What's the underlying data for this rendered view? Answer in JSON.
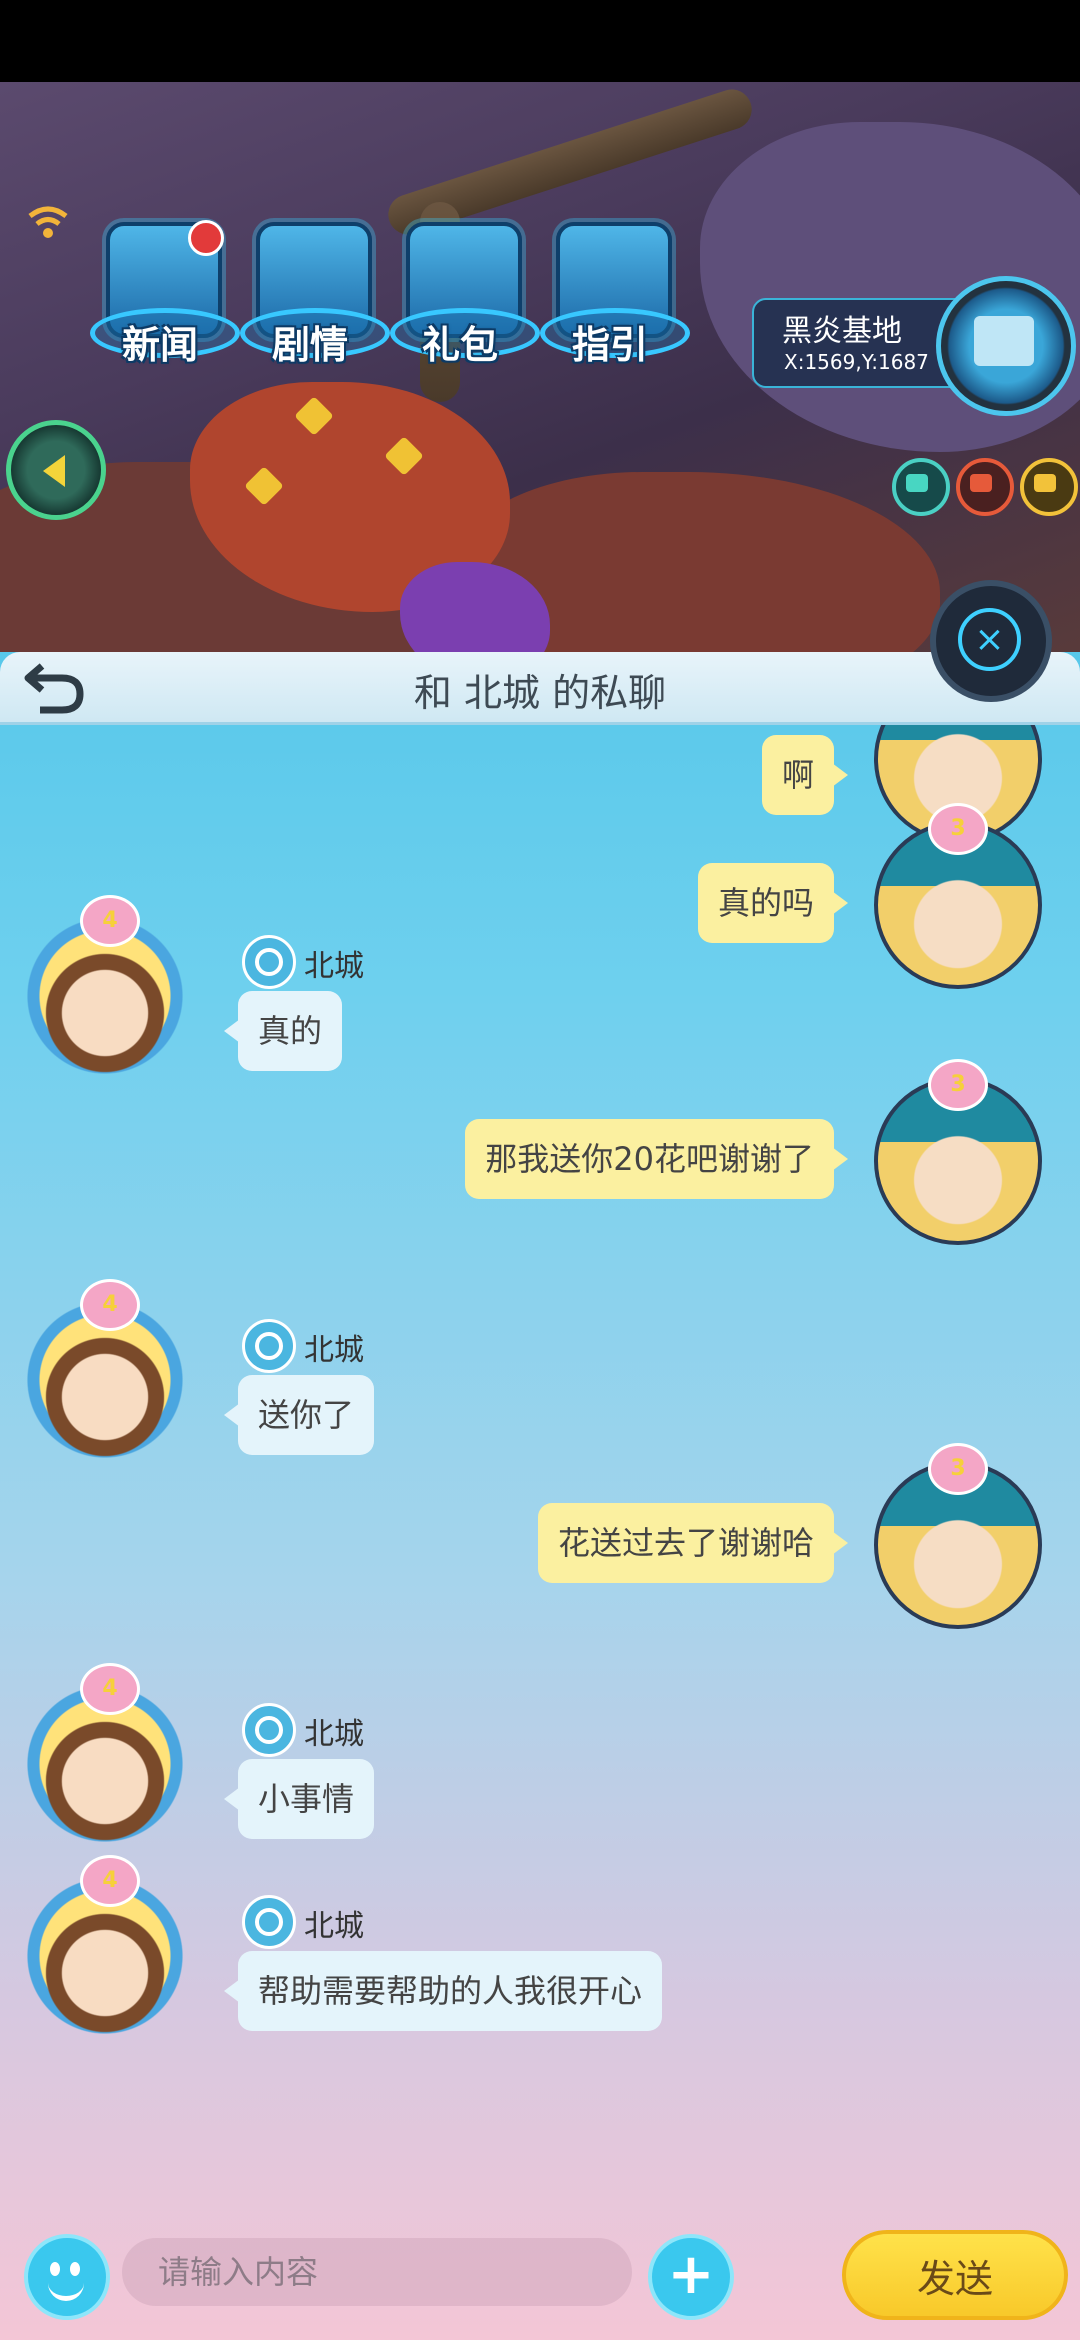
{
  "game_menu": {
    "items": [
      {
        "label": "新闻",
        "badge_dot": true
      },
      {
        "label": "剧情"
      },
      {
        "label": "礼包"
      },
      {
        "label": "指引"
      }
    ]
  },
  "location": {
    "name": "黑炎基地",
    "coords": "X:1569,Y:1687"
  },
  "chat": {
    "title": "和 北城 的私聊",
    "partner_name": "北城",
    "partner_level": "4",
    "my_level": "3",
    "messages": [
      {
        "from": "me",
        "text": "啊"
      },
      {
        "from": "me",
        "text": "真的吗"
      },
      {
        "from": "other",
        "sender": "北城",
        "text": "真的"
      },
      {
        "from": "me",
        "text": "那我送你20花吧谢谢了"
      },
      {
        "from": "other",
        "sender": "北城",
        "text": "送你了"
      },
      {
        "from": "me",
        "text": "花送过去了谢谢哈"
      },
      {
        "from": "other",
        "sender": "北城",
        "text": "小事情"
      },
      {
        "from": "other",
        "sender": "北城",
        "text": "帮助需要帮助的人我很开心"
      }
    ]
  },
  "input": {
    "placeholder": "请输入内容",
    "send_label": "发送",
    "add_label": "+"
  },
  "colors": {
    "my_bubble": "#fbf0a0",
    "other_bubble": "#e4f4fb",
    "send_button": "#f8c92a",
    "accent_blue": "#3ac8ee"
  }
}
